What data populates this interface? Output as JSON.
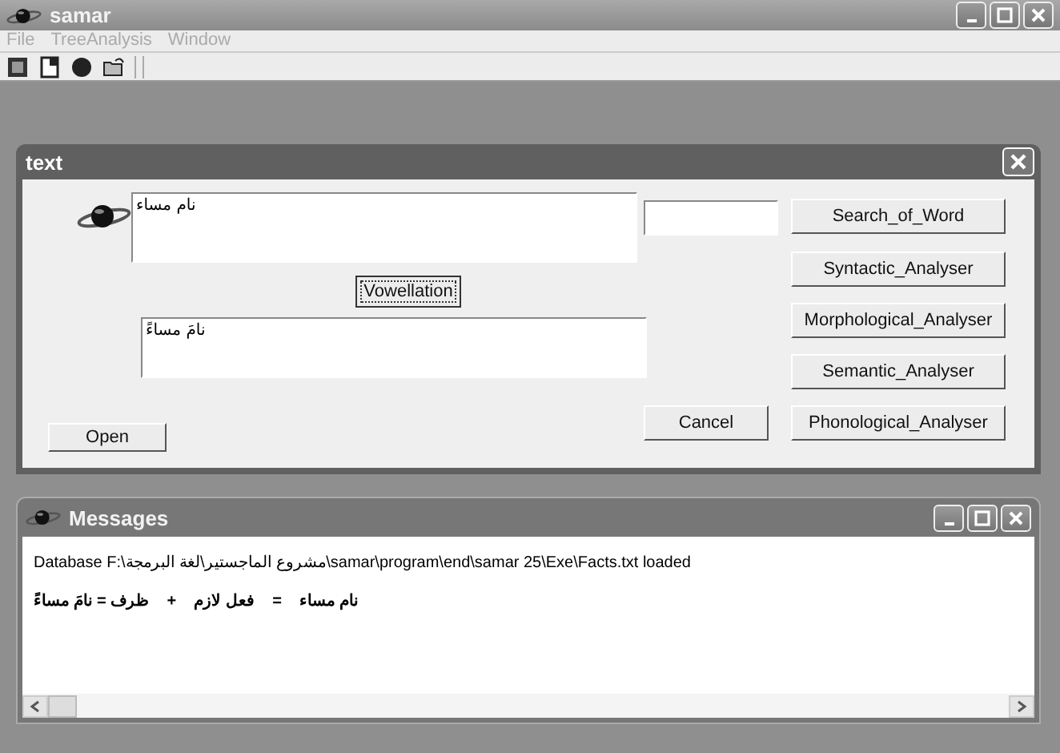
{
  "window": {
    "title": "samar"
  },
  "menu": [
    "File",
    "TreeAnalysis",
    "Window"
  ],
  "text_dialog": {
    "title": "text",
    "input": {
      "value": "نام مساء"
    },
    "vowellation_button": "Vowellation",
    "output": {
      "value": "نامَ مساءً"
    },
    "open_button": "Open",
    "cancel_button": "Cancel",
    "analyser_buttons": [
      "Search_of_Word",
      "Syntactic_Analyser",
      "Morphological_Analyser",
      "Semantic_Analyser",
      "Phonological_Analyser"
    ]
  },
  "messages_window": {
    "title": "Messages",
    "lines": [
      {
        "kind": "ltr",
        "text": "Database F:\\مشروع الماجستير\\لغة البرمجة\\samar\\program\\end\\samar 25\\Exe\\Facts.txt loaded"
      },
      {
        "kind": "rtl",
        "text": "نام مساء    =    فعل لازم    +    ظرف = نامَ مساءً"
      }
    ]
  }
}
